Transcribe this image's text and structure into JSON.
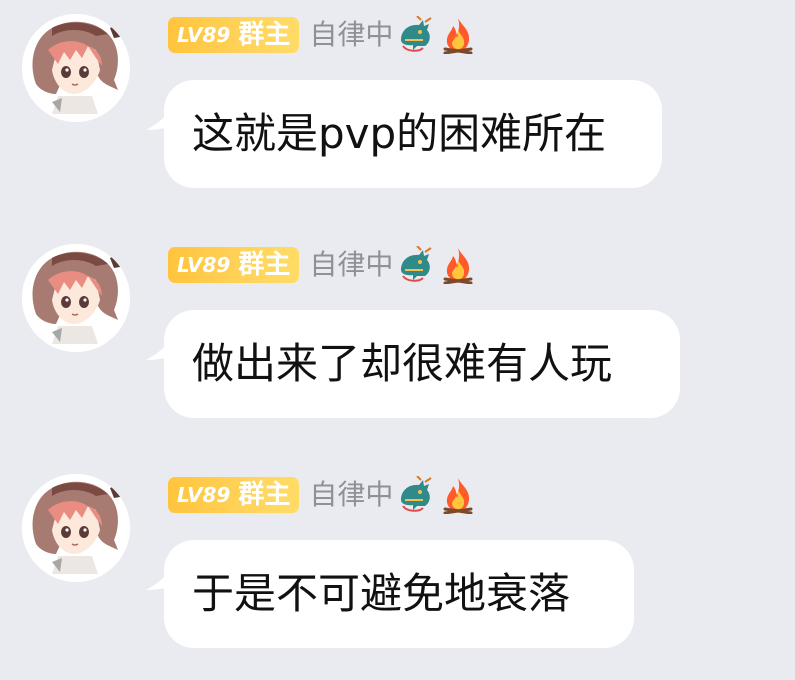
{
  "messages": [
    {
      "level": "LV89",
      "role": "群主",
      "name": "自律中",
      "text": "这就是pvp的困难所在",
      "icons": [
        "dragon-icon",
        "fire-icon"
      ]
    },
    {
      "level": "LV89",
      "role": "群主",
      "name": "自律中",
      "text": "做出来了却很难有人玩",
      "icons": [
        "dragon-icon",
        "fire-icon"
      ]
    },
    {
      "level": "LV89",
      "role": "群主",
      "name": "自律中",
      "text": "于是不可避免地衰落",
      "icons": [
        "dragon-icon",
        "fire-icon"
      ]
    }
  ],
  "colors": {
    "background": "#eaebf1",
    "bubble": "#ffffff",
    "badge": "#ffc43d",
    "name": "#8f9196",
    "text": "#111111"
  }
}
